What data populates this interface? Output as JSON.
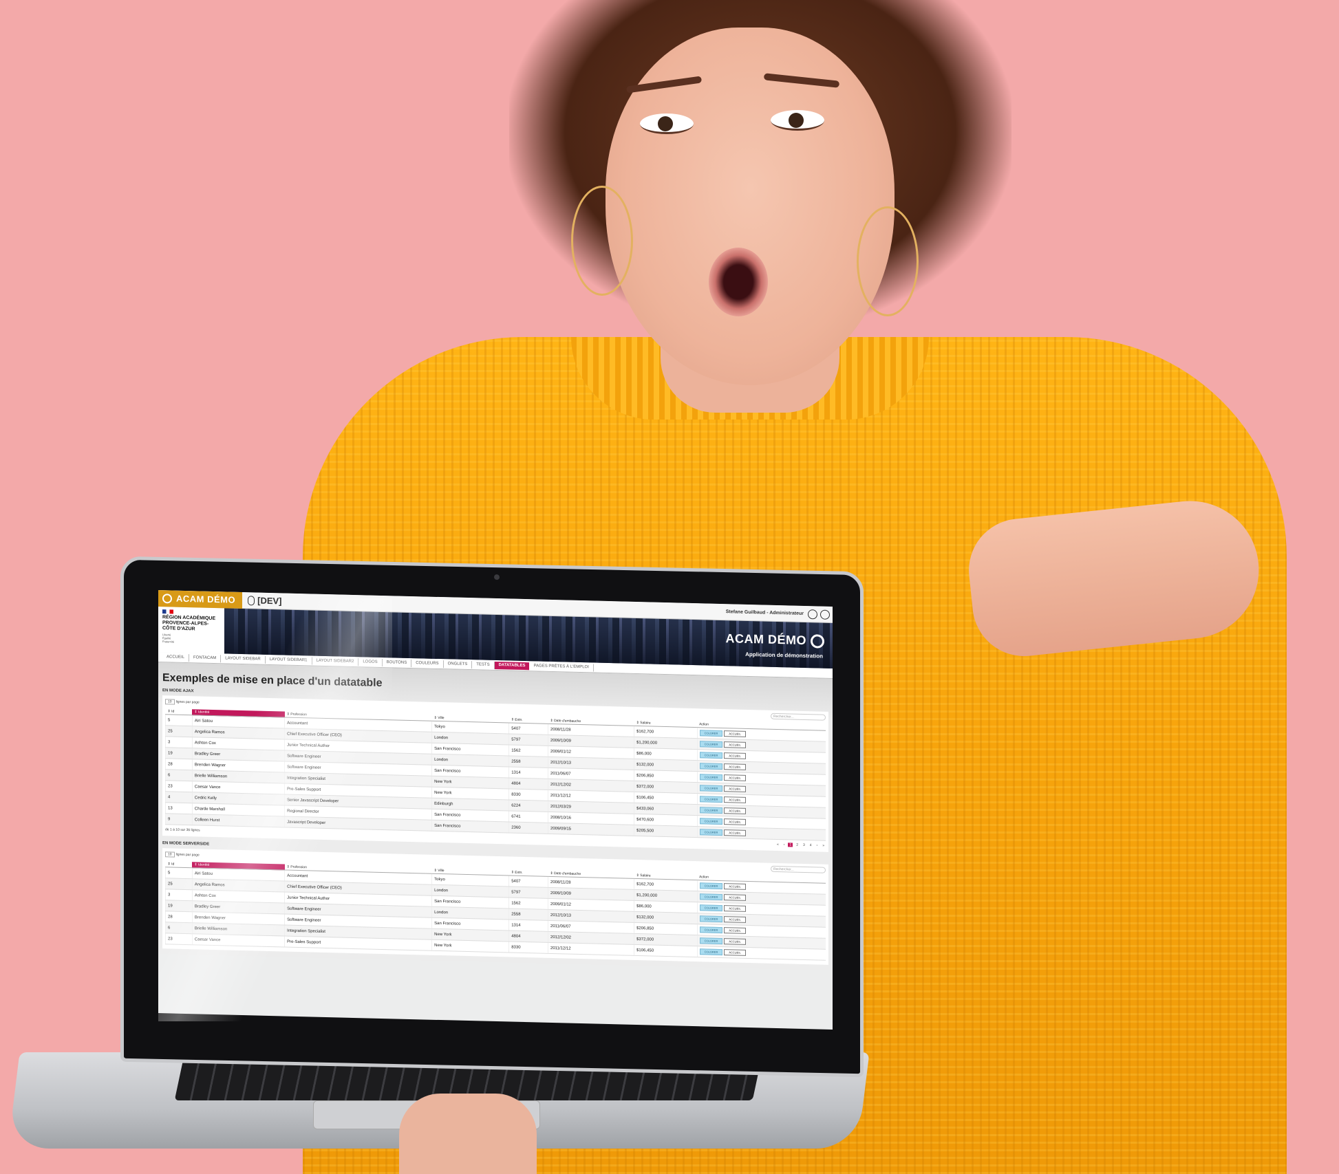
{
  "app": {
    "brand": "ACAM DÉMO",
    "environment": "[DEV]",
    "user": "Stefane Guilbaud - Administrateur",
    "org_lines": [
      "RÉGION ACADÉMIQUE",
      "PROVENCE-ALPES-",
      "CÔTE D'AZUR"
    ],
    "org_motto": [
      "Liberté",
      "Égalité",
      "Fraternité"
    ],
    "banner_title": "ACAM DÉMO",
    "banner_subtitle": "Application de démonstration"
  },
  "nav": {
    "items": [
      "ACCUEIL",
      "FONTACAM",
      "LAYOUT SIDEBAR",
      "LAYOUT SIDEBAR1",
      "LAYOUT SIDEBAR2",
      "LOGOS",
      "BOUTONS",
      "COULEURS",
      "ONGLETS",
      "TESTS",
      "DATATABLES",
      "PAGES PRÊTES À L'EMPLOI"
    ],
    "active": "DATATABLES"
  },
  "page": {
    "title": "Exemples de mise en place d'un datatable",
    "section_ajax": "EN MODE AJAX",
    "section_server": "EN MODE SERVERSIDE"
  },
  "table": {
    "page_size": "10",
    "page_size_label": "lignes par page",
    "search_placeholder": "Rechercher...",
    "columns": [
      "Id",
      "Identité",
      "Profession",
      "Ville",
      "Extn.",
      "Date d'embauche",
      "Salaire",
      "Action"
    ],
    "rows": [
      [
        "5",
        "Airi Satou",
        "Accountant",
        "Tokyo",
        "5407",
        "2008/11/28",
        "$162,700"
      ],
      [
        "25",
        "Angelica Ramos",
        "Chief Executive Officer (CEO)",
        "London",
        "5797",
        "2009/10/09",
        "$1,200,000"
      ],
      [
        "3",
        "Ashton Cox",
        "Junior Technical Author",
        "San Francisco",
        "1562",
        "2009/01/12",
        "$86,000"
      ],
      [
        "19",
        "Bradley Greer",
        "Software Engineer",
        "London",
        "2558",
        "2012/10/13",
        "$132,000"
      ],
      [
        "28",
        "Brenden Wagner",
        "Software Engineer",
        "San Francisco",
        "1314",
        "2011/06/07",
        "$206,850"
      ],
      [
        "6",
        "Brielle Williamson",
        "Integration Specialist",
        "New York",
        "4804",
        "2012/12/02",
        "$372,000"
      ],
      [
        "23",
        "Caesar Vance",
        "Pre-Sales Support",
        "New York",
        "8330",
        "2011/12/12",
        "$106,450"
      ],
      [
        "4",
        "Cedric Kelly",
        "Senior Javascript Developer",
        "Edinburgh",
        "6224",
        "2012/03/29",
        "$433,060"
      ],
      [
        "13",
        "Charde Marshall",
        "Regional Director",
        "San Francisco",
        "6741",
        "2008/10/16",
        "$470,600"
      ],
      [
        "9",
        "Colleen Hurst",
        "Javascript Developer",
        "San Francisco",
        "2360",
        "2009/09/15",
        "$205,500"
      ]
    ],
    "btn_color": "COLORER",
    "btn_home": "ACCUEIL",
    "info": "de 1 à 10 sur 36 lignes",
    "pages": [
      "«",
      "‹",
      "1",
      "2",
      "3",
      "4",
      "›",
      "»"
    ],
    "current_page": "1"
  }
}
